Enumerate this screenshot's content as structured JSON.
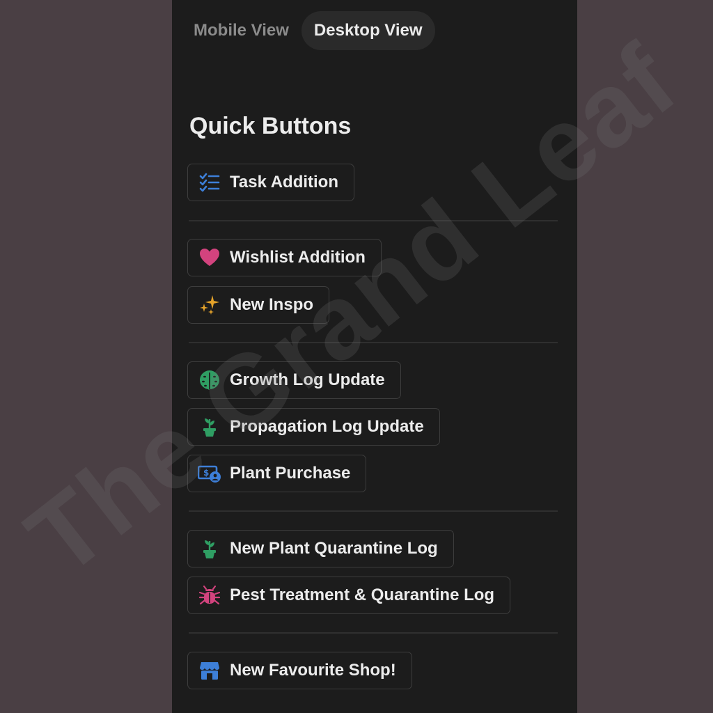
{
  "view_tabs": [
    {
      "label": "Mobile View",
      "active": false
    },
    {
      "label": "Desktop View",
      "active": true
    }
  ],
  "heading": "Quick Buttons",
  "buttons": [
    {
      "label": "Task Addition",
      "icon": "checklist-icon",
      "icon_color": "#3d7fd8"
    },
    {
      "label": "Wishlist Addition",
      "icon": "heart-icon",
      "icon_color": "#d3437e"
    },
    {
      "label": "New Inspo",
      "icon": "sparkles-icon",
      "icon_color": "#e5a32a"
    },
    {
      "label": "Growth Log Update",
      "icon": "monstera-leaf-icon",
      "icon_color": "#2f9e63"
    },
    {
      "label": "Propagation Log Update",
      "icon": "potted-plant-icon",
      "icon_color": "#2f9e63"
    },
    {
      "label": "Plant Purchase",
      "icon": "money-icon",
      "icon_color": "#3d7fd8"
    },
    {
      "label": "New Plant Quarantine Log",
      "icon": "potted-plant-icon",
      "icon_color": "#2f9e63"
    },
    {
      "label": "Pest Treatment & Quarantine Log",
      "icon": "bug-icon",
      "icon_color": "#d3437e"
    },
    {
      "label": "New Favourite Shop!",
      "icon": "shop-icon",
      "icon_color": "#3d7fd8"
    }
  ],
  "watermark": "The Grand Leaf"
}
